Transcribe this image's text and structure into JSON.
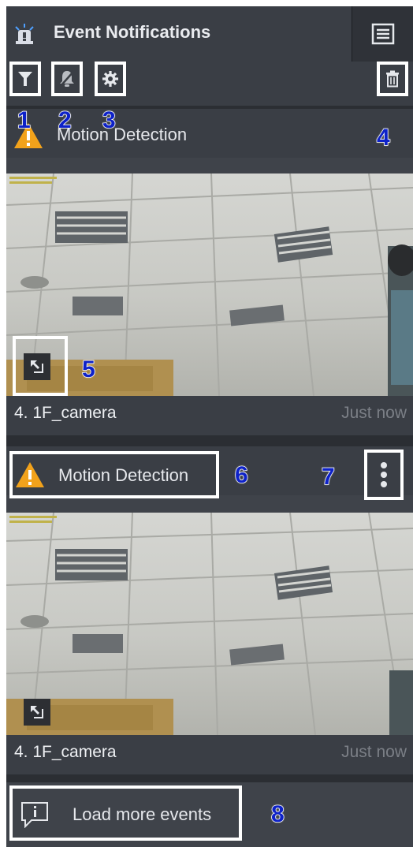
{
  "header": {
    "title": "Event Notifications"
  },
  "toolbar": {
    "filter_icon": "filter-icon",
    "mute_icon": "bell-off-icon",
    "settings_icon": "gear-icon",
    "delete_icon": "trash-icon"
  },
  "events": [
    {
      "type": "Motion Detection",
      "camera": "4. 1F_camera",
      "time": "Just now"
    },
    {
      "type": "Motion Detection",
      "camera": "4. 1F_camera",
      "time": "Just now"
    }
  ],
  "load_more": {
    "label": "Load more events"
  },
  "annotations": [
    "1",
    "2",
    "3",
    "4",
    "5",
    "6",
    "7",
    "8"
  ],
  "colors": {
    "accent_warning": "#f2a21b",
    "badge": "#0e22c8",
    "panel": "#3f434a"
  }
}
